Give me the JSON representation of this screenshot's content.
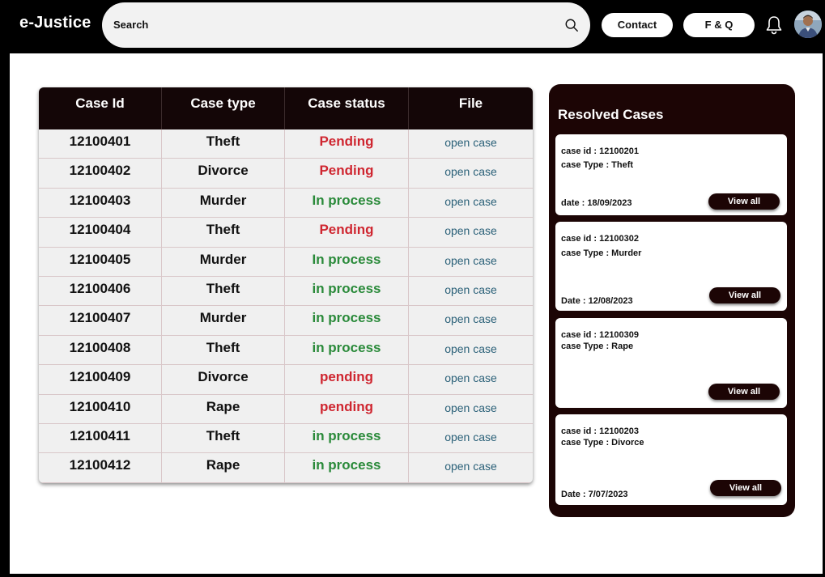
{
  "header": {
    "brand": "e-Justice",
    "search_placeholder": "Search",
    "contact_label": "Contact",
    "faq_label": "F & Q"
  },
  "table": {
    "headers": [
      "Case Id",
      "Case type",
      "Case status",
      "File"
    ],
    "rows": [
      {
        "id": "12100401",
        "type": "Theft",
        "status": "Pending",
        "file": "open case",
        "status_color": "red"
      },
      {
        "id": "12100402",
        "type": "Divorce",
        "status": "Pending",
        "file": "open case",
        "status_color": "red"
      },
      {
        "id": "12100403",
        "type": "Murder",
        "status": "In process",
        "file": "open case",
        "status_color": "green"
      },
      {
        "id": "12100404",
        "type": "Theft",
        "status": "Pending",
        "file": "open case",
        "status_color": "red"
      },
      {
        "id": "12100405",
        "type": "Murder",
        "status": "In process",
        "file": "open case",
        "status_color": "green"
      },
      {
        "id": "12100406",
        "type": "Theft",
        "status": "in process",
        "file": "open case",
        "status_color": "green"
      },
      {
        "id": "12100407",
        "type": "Murder",
        "status": "in process",
        "file": "open case",
        "status_color": "green"
      },
      {
        "id": "12100408",
        "type": "Theft",
        "status": "in process",
        "file": "open case",
        "status_color": "green"
      },
      {
        "id": "12100409",
        "type": "Divorce",
        "status": "pending",
        "file": "open case",
        "status_color": "red"
      },
      {
        "id": "12100410",
        "type": "Rape",
        "status": "pending",
        "file": "open case",
        "status_color": "red"
      },
      {
        "id": "12100411",
        "type": "Theft",
        "status": "in process",
        "file": "open case",
        "status_color": "green"
      },
      {
        "id": "12100412",
        "type": "Rape",
        "status": "in process",
        "file": "open case",
        "status_color": "green"
      }
    ]
  },
  "resolved": {
    "title": "Resolved Cases",
    "view_all_label": "View all",
    "cards": [
      {
        "id_line": "case id : 12100201",
        "type_line": "case Type : Theft",
        "date_line": "date : 18/09/2023"
      },
      {
        "id_line": "case id : 12100302",
        "type_line": "case Type : Murder",
        "date_line": "Date : 12/08/2023"
      },
      {
        "id_line": "case id : 12100309",
        "type_line": "case Type : Rape",
        "date_line": ""
      },
      {
        "id_line": "case id : 12100203",
        "type_line": "case Type : Divorce",
        "date_line": "Date : 7/07/2023"
      }
    ]
  },
  "colors": {
    "status_red": "#cf2630",
    "status_green": "#2a8a3a",
    "link": "#2a6078",
    "dark": "#1c0505"
  }
}
